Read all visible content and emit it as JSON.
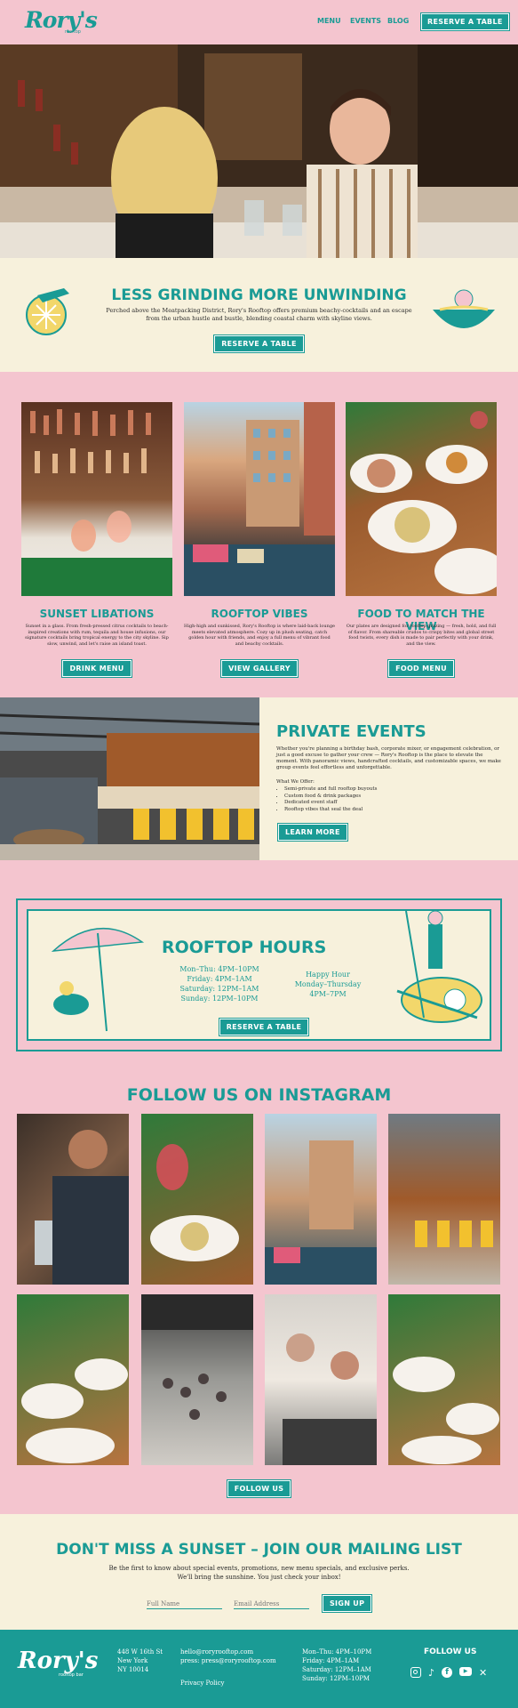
{
  "header": {
    "logo": "Rory's",
    "logo_sub": "rooftop",
    "nav": [
      "MENU",
      "EVENTS",
      "BLOG"
    ],
    "cta": "RESERVE A TABLE"
  },
  "intro": {
    "title": "LESS GRINDING MORE UNWINDING",
    "text": "Perched above the Meatpacking District, Rory's Rooftop offers premium beachy-cocktails and an escape from the urban hustle and bustle, blending coastal charm with skyline views.",
    "cta": "RESERVE A TABLE"
  },
  "features": [
    {
      "title": "SUNSET LIBATIONS",
      "text": "Sunset in a glass. From fresh-pressed citrus cocktails to beach-inspired creations with rum, tequila and house infusions, our signature cocktails bring tropical energy to the city skyline. Sip slow, unwind, and let's raise an island toast.",
      "cta": "DRINK MENU"
    },
    {
      "title": "ROOFTOP VIBES",
      "text": "High-high and sunkissed, Rory's Rooftop is where laid-back lounge meets elevated atmosphere. Cozy up in plush seating, catch golden hour with friends, and enjoy a full menu of vibrant food and beachy cocktails.",
      "cta": "VIEW GALLERY"
    },
    {
      "title": "FOOD TO MATCH THE VIEW",
      "text": "Our plates are designed for rooftop grazing — fresh, bold, and full of flavor. From shareable crudos to crispy bites and global street food twists, every dish is made to pair perfectly with your drink, and the view.",
      "cta": "FOOD MENU"
    }
  ],
  "events": {
    "title": "PRIVATE EVENTS",
    "text": "Whether you're planning a birthday bash, corporate mixer, or engagement celebration, or just a good excuse to gather your crew — Rory's Rooftop is the place to elevate the moment. With panoramic views, handcrafted cocktails, and customizable spaces, we make group events feel effortless and unforgettable.",
    "list_title": "What We Offer:",
    "list": [
      "Semi-private and full rooftop buyouts",
      "Custom food & drink packages",
      "Dedicated event staff",
      "Rooftop vibes that seal the deal"
    ],
    "cta": "LEARN MORE"
  },
  "hours": {
    "title": "ROOFTOP HOURS",
    "lines": [
      "Mon–Thu: 4PM–10PM",
      "Friday: 4PM–1AM",
      "Saturday: 12PM–1AM",
      "Sunday: 12PM–10PM"
    ],
    "happy_title": "Happy Hour",
    "happy_days": "Monday–Thursday",
    "happy_time": "4PM–7PM",
    "cta": "RESERVE A TABLE"
  },
  "instagram": {
    "title": "FOLLOW US ON INSTAGRAM",
    "cta": "FOLLOW US"
  },
  "mailing": {
    "title": "DON'T MISS A SUNSET – JOIN OUR MAILING LIST",
    "text1": "Be the first to know about special events, promotions, new menu specials, and exclusive perks.",
    "text2": "We'll bring the sunshine. You just check your inbox!",
    "name_placeholder": "Full Name",
    "email_placeholder": "Email Address",
    "cta": "SIGN UP"
  },
  "footer": {
    "logo": "Rory's",
    "logo_sub": "rooftop bar",
    "address": [
      "448 W 16th St",
      "New York",
      "NY 10014"
    ],
    "emails": [
      "hello@roryrooftop.com",
      "press: press@roryrooftop.com"
    ],
    "privacy": "Privacy Policy",
    "hours": [
      "Mon–Thu: 4PM–10PM",
      "Friday: 4PM–1AM",
      "Saturday: 12PM–1AM",
      "Sunday: 12PM–10PM"
    ],
    "follow": "FOLLOW US",
    "social_icons": [
      "instagram-icon",
      "tiktok-icon",
      "facebook-icon",
      "youtube-icon",
      "x-icon"
    ]
  },
  "colors": {
    "teal": "#1a9b95",
    "pink": "#f4c5cf",
    "cream": "#f7f1dc"
  }
}
